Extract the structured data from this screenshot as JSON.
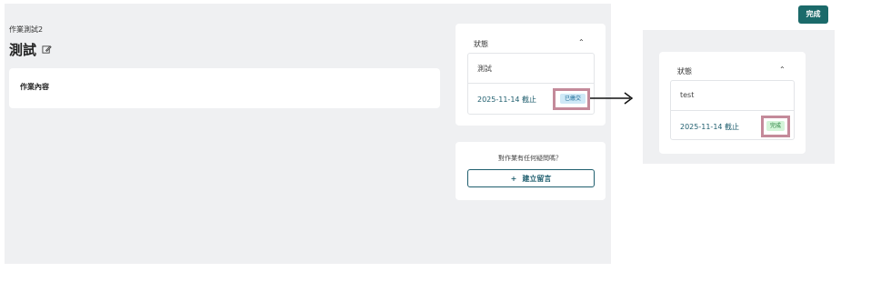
{
  "left": {
    "breadcrumb": "作業測試2",
    "title": "測試",
    "content_label": "作業內容",
    "status": {
      "label": "狀態",
      "item_name": "測試",
      "due": "2025-11-14 截止",
      "badge": "已繳交",
      "badge_color": "#cfe9f7"
    },
    "question": {
      "text": "對作業有任何疑問嗎？",
      "button_label": "建立留言",
      "button_icon": "plus-icon"
    }
  },
  "right": {
    "done_button": "完成",
    "status": {
      "label": "狀態",
      "item_name": "test",
      "due": "2025-11-14 截止",
      "badge": "完成",
      "badge_color": "#d4f5d9"
    }
  },
  "colors": {
    "accent": "#1b6a6a",
    "highlight": "#c48a9a",
    "panel_bg": "#eff0f2"
  }
}
